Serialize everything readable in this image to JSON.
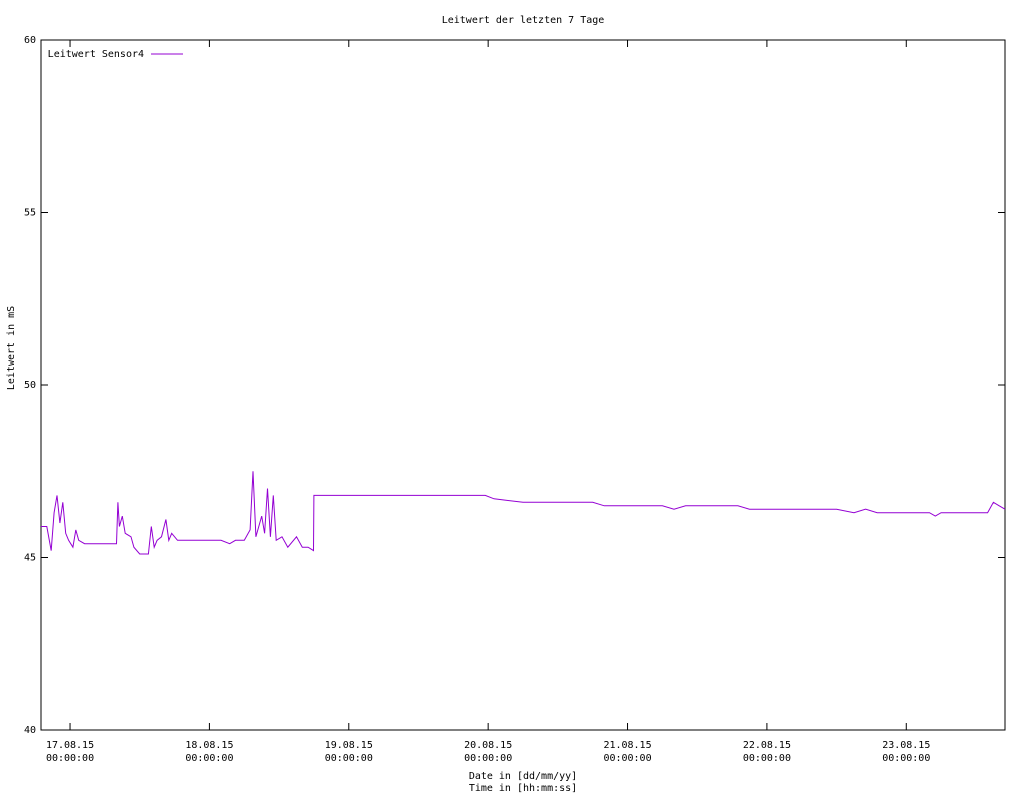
{
  "chart_data": {
    "type": "line",
    "title": "Leitwert der letzten 7 Tage",
    "ylabel": "Leitwert in mS",
    "xlabel_lines": [
      "Date in [dd/mm/yy]",
      "Time in [hh:mm:ss]"
    ],
    "ylim": [
      40,
      60
    ],
    "yticks": [
      40,
      45,
      50,
      55,
      60
    ],
    "xlim": [
      "2015-08-16T19:00:00",
      "2015-08-23T17:00:00"
    ],
    "xticks": [
      {
        "x": "2015-08-17T00:00:00",
        "date": "17.08.15",
        "time": "00:00:00"
      },
      {
        "x": "2015-08-18T00:00:00",
        "date": "18.08.15",
        "time": "00:00:00"
      },
      {
        "x": "2015-08-19T00:00:00",
        "date": "19.08.15",
        "time": "00:00:00"
      },
      {
        "x": "2015-08-20T00:00:00",
        "date": "20.08.15",
        "time": "00:00:00"
      },
      {
        "x": "2015-08-21T00:00:00",
        "date": "21.08.15",
        "time": "00:00:00"
      },
      {
        "x": "2015-08-22T00:00:00",
        "date": "22.08.15",
        "time": "00:00:00"
      },
      {
        "x": "2015-08-23T00:00:00",
        "date": "23.08.15",
        "time": "00:00:00"
      }
    ],
    "grid": false,
    "legend": "top-left",
    "series": [
      {
        "name": "Leitwert Sensor4",
        "color": "#9400d3",
        "points": [
          [
            "2015-08-16T19:00:00",
            45.9
          ],
          [
            "2015-08-16T20:00:00",
            45.9
          ],
          [
            "2015-08-16T20:45:00",
            45.2
          ],
          [
            "2015-08-16T21:15:00",
            46.3
          ],
          [
            "2015-08-16T21:45:00",
            46.8
          ],
          [
            "2015-08-16T22:15:00",
            46.0
          ],
          [
            "2015-08-16T22:45:00",
            46.6
          ],
          [
            "2015-08-16T23:15:00",
            45.7
          ],
          [
            "2015-08-16T23:45:00",
            45.5
          ],
          [
            "2015-08-17T00:30:00",
            45.3
          ],
          [
            "2015-08-17T01:00:00",
            45.8
          ],
          [
            "2015-08-17T01:30:00",
            45.5
          ],
          [
            "2015-08-17T02:30:00",
            45.4
          ],
          [
            "2015-08-17T04:00:00",
            45.4
          ],
          [
            "2015-08-17T05:30:00",
            45.4
          ],
          [
            "2015-08-17T07:00:00",
            45.4
          ],
          [
            "2015-08-17T08:00:00",
            45.4
          ],
          [
            "2015-08-17T08:15:00",
            46.6
          ],
          [
            "2015-08-17T08:30:00",
            45.9
          ],
          [
            "2015-08-17T09:00:00",
            46.2
          ],
          [
            "2015-08-17T09:30:00",
            45.7
          ],
          [
            "2015-08-17T10:30:00",
            45.6
          ],
          [
            "2015-08-17T11:00:00",
            45.3
          ],
          [
            "2015-08-17T12:00:00",
            45.1
          ],
          [
            "2015-08-17T13:30:00",
            45.1
          ],
          [
            "2015-08-17T14:00:00",
            45.9
          ],
          [
            "2015-08-17T14:30:00",
            45.3
          ],
          [
            "2015-08-17T15:00:00",
            45.5
          ],
          [
            "2015-08-17T15:45:00",
            45.6
          ],
          [
            "2015-08-17T16:30:00",
            46.1
          ],
          [
            "2015-08-17T17:00:00",
            45.5
          ],
          [
            "2015-08-17T17:30:00",
            45.7
          ],
          [
            "2015-08-17T18:30:00",
            45.5
          ],
          [
            "2015-08-17T20:00:00",
            45.5
          ],
          [
            "2015-08-17T22:00:00",
            45.5
          ],
          [
            "2015-08-18T00:00:00",
            45.5
          ],
          [
            "2015-08-18T02:00:00",
            45.5
          ],
          [
            "2015-08-18T03:30:00",
            45.4
          ],
          [
            "2015-08-18T04:30:00",
            45.5
          ],
          [
            "2015-08-18T06:00:00",
            45.5
          ],
          [
            "2015-08-18T07:00:00",
            45.8
          ],
          [
            "2015-08-18T07:30:00",
            47.5
          ],
          [
            "2015-08-18T08:00:00",
            45.6
          ],
          [
            "2015-08-18T09:00:00",
            46.2
          ],
          [
            "2015-08-18T09:30:00",
            45.7
          ],
          [
            "2015-08-18T10:00:00",
            47.0
          ],
          [
            "2015-08-18T10:30:00",
            45.6
          ],
          [
            "2015-08-18T11:00:00",
            46.8
          ],
          [
            "2015-08-18T11:30:00",
            45.5
          ],
          [
            "2015-08-18T12:30:00",
            45.6
          ],
          [
            "2015-08-18T13:30:00",
            45.3
          ],
          [
            "2015-08-18T15:00:00",
            45.6
          ],
          [
            "2015-08-18T16:00:00",
            45.3
          ],
          [
            "2015-08-18T17:00:00",
            45.3
          ],
          [
            "2015-08-18T17:55:00",
            45.2
          ],
          [
            "2015-08-18T18:00:00",
            46.8
          ],
          [
            "2015-08-19T00:00:00",
            46.8
          ],
          [
            "2015-08-19T06:00:00",
            46.8
          ],
          [
            "2015-08-19T12:00:00",
            46.8
          ],
          [
            "2015-08-19T18:00:00",
            46.8
          ],
          [
            "2015-08-19T23:30:00",
            46.8
          ],
          [
            "2015-08-20T01:00:00",
            46.7
          ],
          [
            "2015-08-20T06:00:00",
            46.6
          ],
          [
            "2015-08-20T12:00:00",
            46.6
          ],
          [
            "2015-08-20T18:00:00",
            46.6
          ],
          [
            "2015-08-20T20:00:00",
            46.5
          ],
          [
            "2015-08-21T00:00:00",
            46.5
          ],
          [
            "2015-08-21T06:00:00",
            46.5
          ],
          [
            "2015-08-21T08:00:00",
            46.4
          ],
          [
            "2015-08-21T10:00:00",
            46.5
          ],
          [
            "2015-08-21T14:00:00",
            46.5
          ],
          [
            "2015-08-21T19:00:00",
            46.5
          ],
          [
            "2015-08-21T21:00:00",
            46.4
          ],
          [
            "2015-08-22T02:00:00",
            46.4
          ],
          [
            "2015-08-22T08:00:00",
            46.4
          ],
          [
            "2015-08-22T12:00:00",
            46.4
          ],
          [
            "2015-08-22T15:00:00",
            46.3
          ],
          [
            "2015-08-22T17:00:00",
            46.4
          ],
          [
            "2015-08-22T19:00:00",
            46.3
          ],
          [
            "2015-08-23T00:00:00",
            46.3
          ],
          [
            "2015-08-23T04:00:00",
            46.3
          ],
          [
            "2015-08-23T05:00:00",
            46.2
          ],
          [
            "2015-08-23T06:00:00",
            46.3
          ],
          [
            "2015-08-23T10:00:00",
            46.3
          ],
          [
            "2015-08-23T14:00:00",
            46.3
          ],
          [
            "2015-08-23T15:00:00",
            46.6
          ],
          [
            "2015-08-23T16:00:00",
            46.5
          ],
          [
            "2015-08-23T17:00:00",
            46.4
          ]
        ]
      }
    ]
  }
}
